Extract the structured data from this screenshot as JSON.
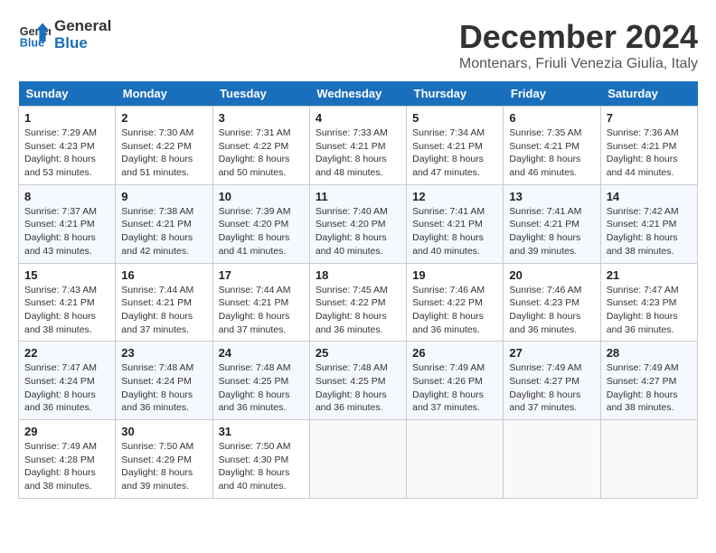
{
  "logo": {
    "line1": "General",
    "line2": "Blue"
  },
  "title": "December 2024",
  "subtitle": "Montenars, Friuli Venezia Giulia, Italy",
  "days_of_week": [
    "Sunday",
    "Monday",
    "Tuesday",
    "Wednesday",
    "Thursday",
    "Friday",
    "Saturday"
  ],
  "weeks": [
    [
      {
        "day": "1",
        "sunrise": "7:29 AM",
        "sunset": "4:23 PM",
        "daylight": "8 hours and 53 minutes."
      },
      {
        "day": "2",
        "sunrise": "7:30 AM",
        "sunset": "4:22 PM",
        "daylight": "8 hours and 51 minutes."
      },
      {
        "day": "3",
        "sunrise": "7:31 AM",
        "sunset": "4:22 PM",
        "daylight": "8 hours and 50 minutes."
      },
      {
        "day": "4",
        "sunrise": "7:33 AM",
        "sunset": "4:21 PM",
        "daylight": "8 hours and 48 minutes."
      },
      {
        "day": "5",
        "sunrise": "7:34 AM",
        "sunset": "4:21 PM",
        "daylight": "8 hours and 47 minutes."
      },
      {
        "day": "6",
        "sunrise": "7:35 AM",
        "sunset": "4:21 PM",
        "daylight": "8 hours and 46 minutes."
      },
      {
        "day": "7",
        "sunrise": "7:36 AM",
        "sunset": "4:21 PM",
        "daylight": "8 hours and 44 minutes."
      }
    ],
    [
      {
        "day": "8",
        "sunrise": "7:37 AM",
        "sunset": "4:21 PM",
        "daylight": "8 hours and 43 minutes."
      },
      {
        "day": "9",
        "sunrise": "7:38 AM",
        "sunset": "4:21 PM",
        "daylight": "8 hours and 42 minutes."
      },
      {
        "day": "10",
        "sunrise": "7:39 AM",
        "sunset": "4:20 PM",
        "daylight": "8 hours and 41 minutes."
      },
      {
        "day": "11",
        "sunrise": "7:40 AM",
        "sunset": "4:20 PM",
        "daylight": "8 hours and 40 minutes."
      },
      {
        "day": "12",
        "sunrise": "7:41 AM",
        "sunset": "4:21 PM",
        "daylight": "8 hours and 40 minutes."
      },
      {
        "day": "13",
        "sunrise": "7:41 AM",
        "sunset": "4:21 PM",
        "daylight": "8 hours and 39 minutes."
      },
      {
        "day": "14",
        "sunrise": "7:42 AM",
        "sunset": "4:21 PM",
        "daylight": "8 hours and 38 minutes."
      }
    ],
    [
      {
        "day": "15",
        "sunrise": "7:43 AM",
        "sunset": "4:21 PM",
        "daylight": "8 hours and 38 minutes."
      },
      {
        "day": "16",
        "sunrise": "7:44 AM",
        "sunset": "4:21 PM",
        "daylight": "8 hours and 37 minutes."
      },
      {
        "day": "17",
        "sunrise": "7:44 AM",
        "sunset": "4:21 PM",
        "daylight": "8 hours and 37 minutes."
      },
      {
        "day": "18",
        "sunrise": "7:45 AM",
        "sunset": "4:22 PM",
        "daylight": "8 hours and 36 minutes."
      },
      {
        "day": "19",
        "sunrise": "7:46 AM",
        "sunset": "4:22 PM",
        "daylight": "8 hours and 36 minutes."
      },
      {
        "day": "20",
        "sunrise": "7:46 AM",
        "sunset": "4:23 PM",
        "daylight": "8 hours and 36 minutes."
      },
      {
        "day": "21",
        "sunrise": "7:47 AM",
        "sunset": "4:23 PM",
        "daylight": "8 hours and 36 minutes."
      }
    ],
    [
      {
        "day": "22",
        "sunrise": "7:47 AM",
        "sunset": "4:24 PM",
        "daylight": "8 hours and 36 minutes."
      },
      {
        "day": "23",
        "sunrise": "7:48 AM",
        "sunset": "4:24 PM",
        "daylight": "8 hours and 36 minutes."
      },
      {
        "day": "24",
        "sunrise": "7:48 AM",
        "sunset": "4:25 PM",
        "daylight": "8 hours and 36 minutes."
      },
      {
        "day": "25",
        "sunrise": "7:48 AM",
        "sunset": "4:25 PM",
        "daylight": "8 hours and 36 minutes."
      },
      {
        "day": "26",
        "sunrise": "7:49 AM",
        "sunset": "4:26 PM",
        "daylight": "8 hours and 37 minutes."
      },
      {
        "day": "27",
        "sunrise": "7:49 AM",
        "sunset": "4:27 PM",
        "daylight": "8 hours and 37 minutes."
      },
      {
        "day": "28",
        "sunrise": "7:49 AM",
        "sunset": "4:27 PM",
        "daylight": "8 hours and 38 minutes."
      }
    ],
    [
      {
        "day": "29",
        "sunrise": "7:49 AM",
        "sunset": "4:28 PM",
        "daylight": "8 hours and 38 minutes."
      },
      {
        "day": "30",
        "sunrise": "7:50 AM",
        "sunset": "4:29 PM",
        "daylight": "8 hours and 39 minutes."
      },
      {
        "day": "31",
        "sunrise": "7:50 AM",
        "sunset": "4:30 PM",
        "daylight": "8 hours and 40 minutes."
      },
      null,
      null,
      null,
      null
    ]
  ],
  "labels": {
    "sunrise": "Sunrise:",
    "sunset": "Sunset:",
    "daylight": "Daylight:"
  }
}
